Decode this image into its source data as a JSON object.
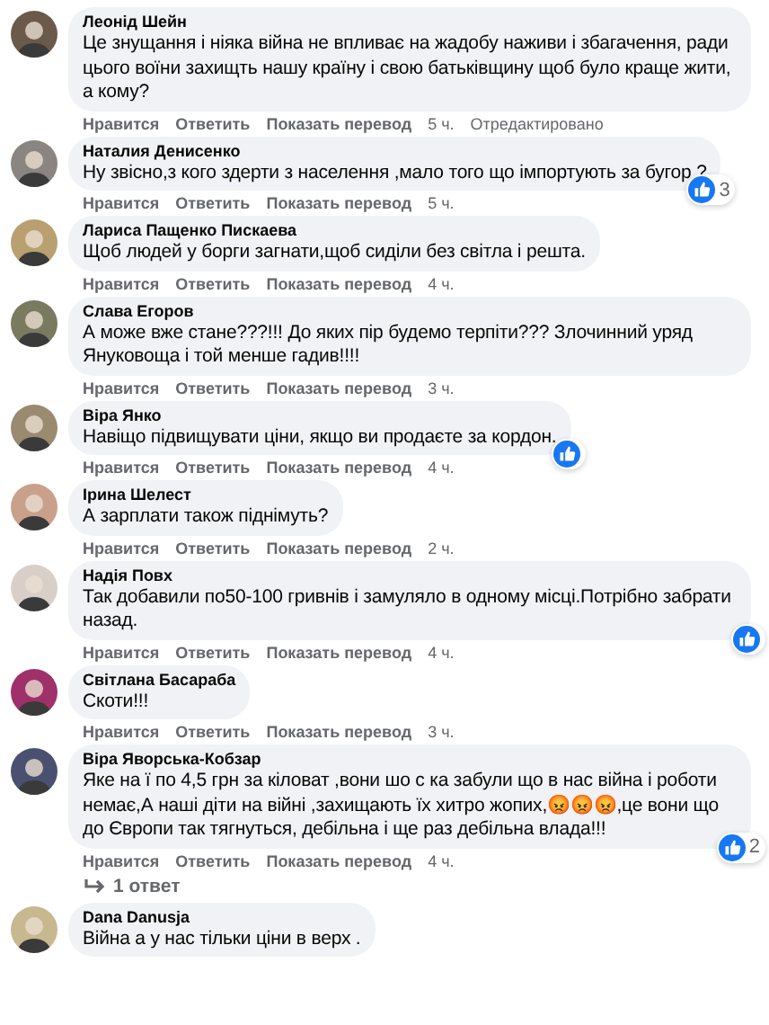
{
  "comments": [
    {
      "author": "Леонід Шейн",
      "text": "Це знущання і ніяка війна не впливає на жадобу наживи і збагачення, ради цього воїни захищть нашу країну і свою батьківщину щоб було краще жити, а кому?",
      "actions": [
        "Нравится",
        "Ответить",
        "Показать перевод"
      ],
      "time": "5 ч.",
      "edited": "Отредактировано"
    },
    {
      "author": "Наталия Денисенко",
      "text": "Ну звісно,з кого здерти з населення ,мало того що імпортують за бугор ?",
      "actions": [
        "Нравится",
        "Ответить",
        "Показать перевод"
      ],
      "time": "5 ч.",
      "reaction": {
        "kind": "like",
        "count": "3"
      }
    },
    {
      "author": "Лариса Пащенко Пискаева",
      "text": "Щоб людей у борги загнати,щоб сиділи без світла і решта.",
      "actions": [
        "Нравится",
        "Ответить",
        "Показать перевод"
      ],
      "time": "4 ч."
    },
    {
      "author": "Слава Егоров",
      "text": "А може вже стане???!!! До яких пір будемо терпіти??? Злочинний уряд Януковоща і той менше гадив!!!!",
      "actions": [
        "Нравится",
        "Ответить",
        "Показать перевод"
      ],
      "time": "3 ч."
    },
    {
      "author": "Віра Янко",
      "text": "Навіщо підвищувати ціни, якщо ви продаєте за кордон.",
      "actions": [
        "Нравится",
        "Ответить",
        "Показать перевод"
      ],
      "time": "4 ч.",
      "reaction": {
        "kind": "like"
      }
    },
    {
      "author": "Ірина Шелест",
      "text": "А зарплати також піднімуть?",
      "actions": [
        "Нравится",
        "Ответить",
        "Показать перевод"
      ],
      "time": "2 ч."
    },
    {
      "author": "Надія Повх",
      "text": "Так добавили по50-100 гривнів і замуляло в одному місці.Потрібно забрати назад.",
      "actions": [
        "Нравится",
        "Ответить",
        "Показать перевод"
      ],
      "time": "4 ч.",
      "reaction": {
        "kind": "like"
      }
    },
    {
      "author": "Світлана Басараба",
      "text": "Скоти!!!",
      "actions": [
        "Нравится",
        "Ответить",
        "Показать перевод"
      ],
      "time": "3 ч."
    },
    {
      "author": "Віра Яворська-Кобзар",
      "text": "Яке на ї по 4,5 грн за кіловат ,вони шо с ка забули що в нас війна і роботи немає,А наші діти на війні ,захищають їх хитро жопих,😡😡😡,це вони що до Європи так тягнуться, дебільна і ще раз дебільна влада!!!",
      "actions": [
        "Нравится",
        "Ответить",
        "Показать перевод"
      ],
      "time": "4 ч.",
      "reaction": {
        "kind": "like",
        "count": "2"
      },
      "replies": "1 ответ"
    },
    {
      "author": "Dana Danusja",
      "text": "Війна а у нас тільки ціни в верх ."
    }
  ]
}
